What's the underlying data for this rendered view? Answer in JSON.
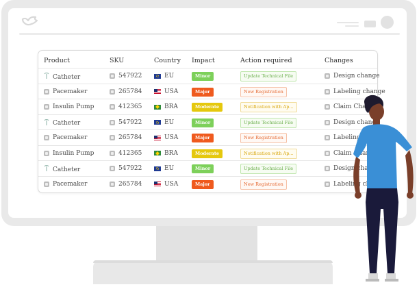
{
  "table": {
    "headers": {
      "product": "Product",
      "sku": "SKU",
      "country": "Country",
      "impact": "Impact",
      "action": "Action required",
      "changes": "Changes"
    },
    "rows": [
      {
        "product": "Catheter",
        "sku": "547922",
        "country": "EU",
        "impact": "Minor",
        "action": "Update Technical File",
        "changes": "Design change"
      },
      {
        "product": "Pacemaker",
        "sku": "265784",
        "country": "USA",
        "impact": "Major",
        "action": "New Registration",
        "changes": "Labeling change"
      },
      {
        "product": "Insulin Pump",
        "sku": "412365",
        "country": "BRA",
        "impact": "Moderate",
        "action": "Notification with Ap...",
        "changes": "Claim Change"
      },
      {
        "product": "Catheter",
        "sku": "547922",
        "country": "EU",
        "impact": "Minor",
        "action": "Update Technical File",
        "changes": "Design change"
      },
      {
        "product": "Pacemaker",
        "sku": "265784",
        "country": "USA",
        "impact": "Major",
        "action": "New Registration",
        "changes": "Labeling change"
      },
      {
        "product": "Insulin Pump",
        "sku": "412365",
        "country": "BRA",
        "impact": "Moderate",
        "action": "Notification with Ap...",
        "changes": "Claim Change"
      },
      {
        "product": "Catheter",
        "sku": "547922",
        "country": "EU",
        "impact": "Minor",
        "action": "Update Technical File",
        "changes": "Design change"
      },
      {
        "product": "Pacemaker",
        "sku": "265784",
        "country": "USA",
        "impact": "Major",
        "action": "New Registration",
        "changes": "Labeling change"
      }
    ]
  },
  "colors": {
    "minor": "#7dd05a",
    "major": "#ef5a1e",
    "moderate": "#e5c80d",
    "person_shirt": "#3a8fd6",
    "person_pants": "#1a1a3a"
  },
  "icons": {
    "logo": "bird-logo-icon",
    "catheter": "catheter-icon",
    "device": "device-icon"
  }
}
